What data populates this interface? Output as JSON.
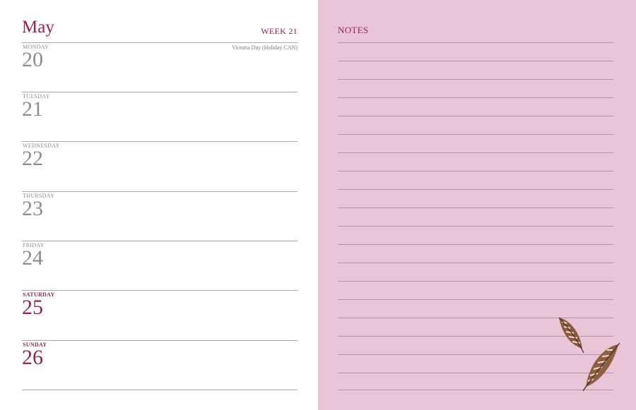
{
  "left_page": {
    "month": "May",
    "week": "WEEK 21",
    "days": [
      {
        "name": "MONDAY",
        "number": "20",
        "note": "Victoria Day (Holiday CAN)"
      },
      {
        "name": "TUESDAY",
        "number": "21"
      },
      {
        "name": "WEDNESDAY",
        "number": "22"
      },
      {
        "name": "THURSDAY",
        "number": "23"
      },
      {
        "name": "FRIDAY",
        "number": "24"
      },
      {
        "name": "SATURDAY",
        "number": "25"
      },
      {
        "name": "SUNDAY",
        "number": "26"
      }
    ]
  },
  "right_page": {
    "title": "NOTES",
    "decoration": [
      "feather-icon",
      "feather-icon"
    ]
  },
  "colors": {
    "accent": "#9b2150",
    "weekday_text": "#8d8d8d",
    "notes_background": "#e8c5d7",
    "rule": "#a9a9a9"
  }
}
